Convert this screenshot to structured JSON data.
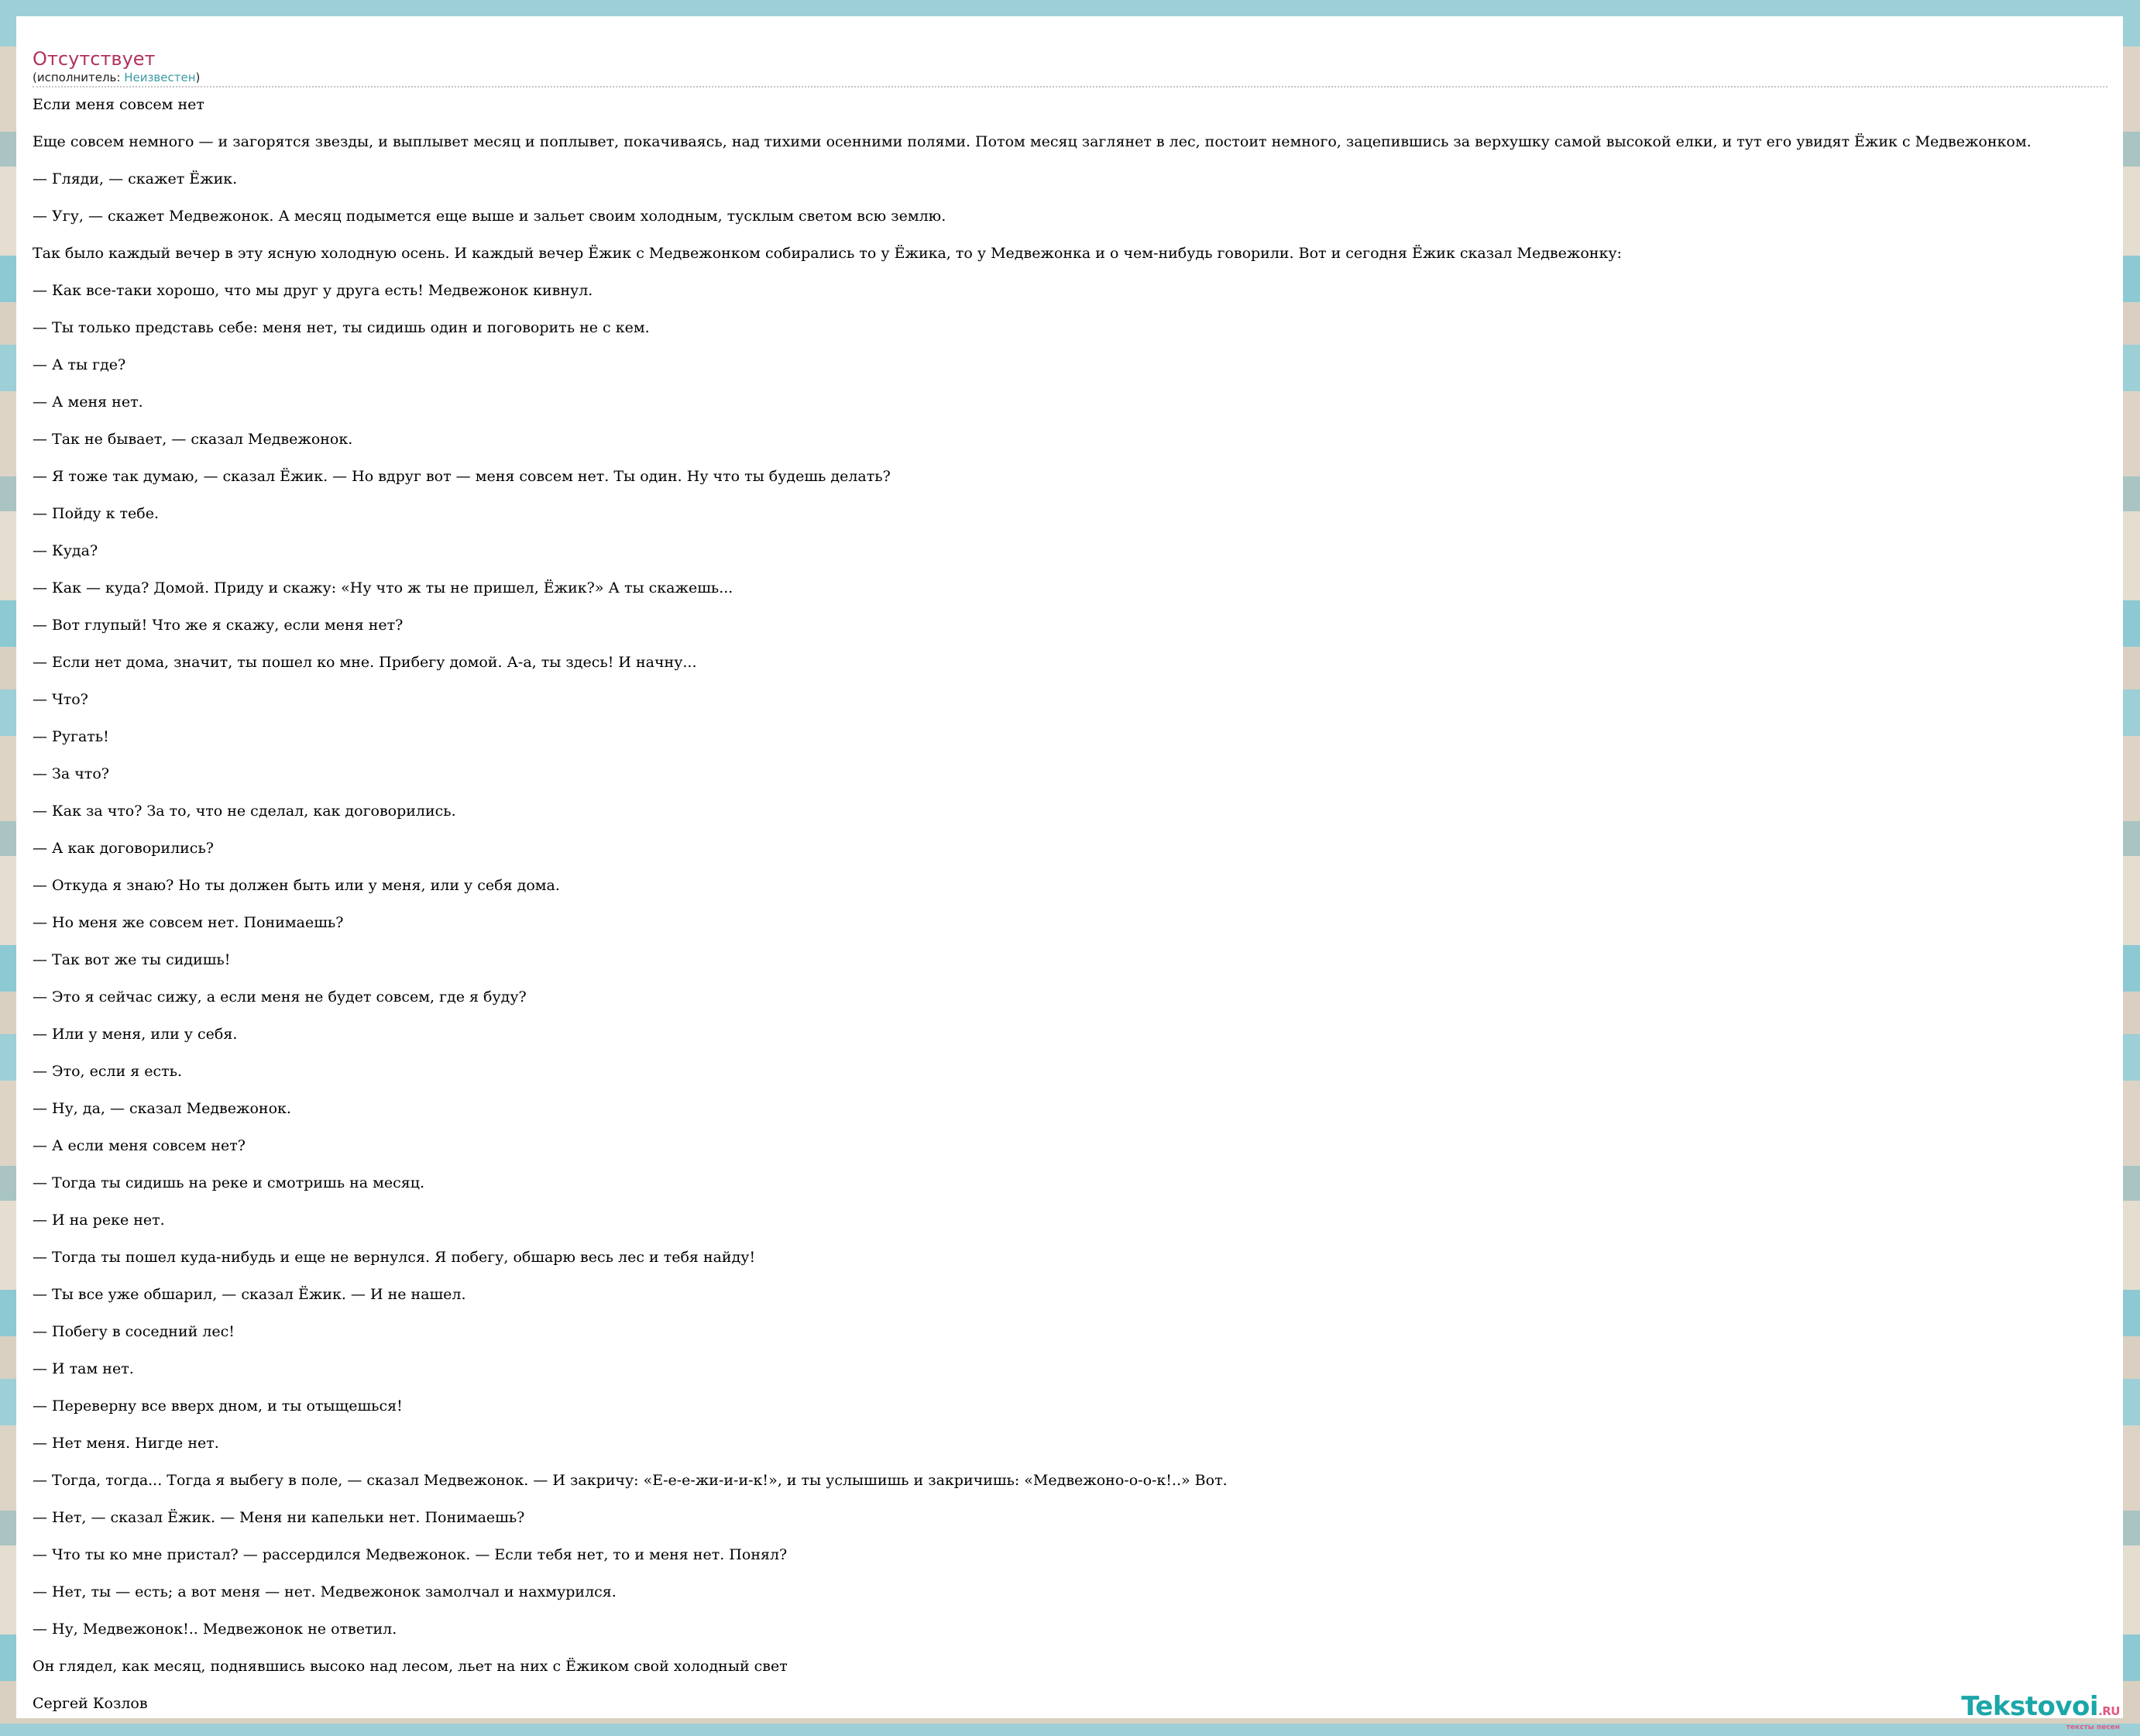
{
  "song": {
    "title": "Отсутствует",
    "artist_prefix": "(исполнитель: ",
    "artist_name": "Неизвестен",
    "artist_suffix": ")"
  },
  "lyrics": [
    "Если меня совсем нет",
    "Еще совсем немного — и загорятся звезды, и выплывет месяц и поплывет, покачиваясь, над тихими осенними полями. Потом месяц заглянет в лес, постоит немного, зацепившись за верхушку самой высокой елки, и тут его увидят Ёжик с Медвежонком.",
    "— Гляди, — скажет Ёжик.",
    "— Угу, — скажет Медвежонок. А месяц подымется еще выше и зальет своим холодным, тусклым светом всю землю.",
    "Так было каждый вечер в эту ясную холодную осень. И каждый вечер Ёжик с Медвежонком собирались то у Ёжика, то у Медвежонка и о чем-нибудь говорили. Вот и сегодня Ёжик сказал Медвежонку:",
    "— Как все-таки хорошо, что мы друг у друга есть! Медвежонок кивнул.",
    "— Ты только представь себе: меня нет, ты сидишь один и поговорить не с кем.",
    "— А ты где?",
    "— А меня нет.",
    "— Так не бывает, — сказал Медвежонок.",
    "— Я тоже так думаю, — сказал Ёжик. — Но вдруг вот — меня совсем нет. Ты один. Ну что ты будешь делать?",
    "— Пойду к тебе.",
    "— Куда?",
    "— Как — куда? Домой. Приду и скажу: «Ну что ж ты не пришел, Ёжик?» А ты скажешь...",
    "— Вот глупый! Что же я скажу, если меня нет?",
    "— Если нет дома, значит, ты пошел ко мне. Прибегу домой. А-а, ты здесь! И начну...",
    "— Что?",
    "— Ругать!",
    "— За что?",
    "— Как за что? За то, что не сделал, как договорились.",
    "— А как договорились?",
    "— Откуда я знаю? Но ты должен быть или у меня, или у себя дома.",
    "— Но меня же совсем нет. Понимаешь?",
    "— Так вот же ты сидишь!",
    "— Это я сейчас сижу, а если меня не будет совсем, где я буду?",
    "— Или у меня, или у себя.",
    "— Это, если я есть.",
    "— Ну, да, — сказал Медвежонок.",
    "— А если меня совсем нет?",
    "— Тогда ты сидишь на реке и смотришь на месяц.",
    "— И на реке нет.",
    "— Тогда ты пошел куда-нибудь и еще не вернулся. Я побегу, обшарю весь лес и тебя найду!",
    "— Ты все уже обшарил, — сказал Ёжик. — И не нашел.",
    "— Побегу в соседний лес!",
    "— И там нет.",
    "— Переверну все вверх дном, и ты отыщешься!",
    "— Нет меня. Нигде нет.",
    "— Тогда, тогда... Тогда я выбегу в поле, — сказал Медвежонок. — И закричу: «Е-е-е-жи-и-и-к!», и ты услышишь и закричишь: «Медвежоно-о-о-к!..» Вот.",
    "— Нет, — сказал Ёжик. — Меня ни капельки нет. Понимаешь?",
    "— Что ты ко мне пристал? — рассердился Медвежонок. — Если тебя нет, то и меня нет. Понял?",
    "— Нет, ты — есть; а вот меня —  нет. Медвежонок замолчал и нахмурился.",
    "— Ну, Медвежонок!.. Медвежонок не ответил.",
    "Он глядел, как месяц, поднявшись высоко над лесом, льет на них с Ёжиком свой холодный свет",
    "Сергей Козлов"
  ],
  "logo": {
    "name": "Tekstovoi",
    "tld": ".RU",
    "tagline": "тексты песен"
  },
  "colors": {
    "title": "#b0325f",
    "artist_link": "#3a9aa6",
    "logo_main": "#1ba6a8",
    "logo_accent": "#e05a83"
  }
}
